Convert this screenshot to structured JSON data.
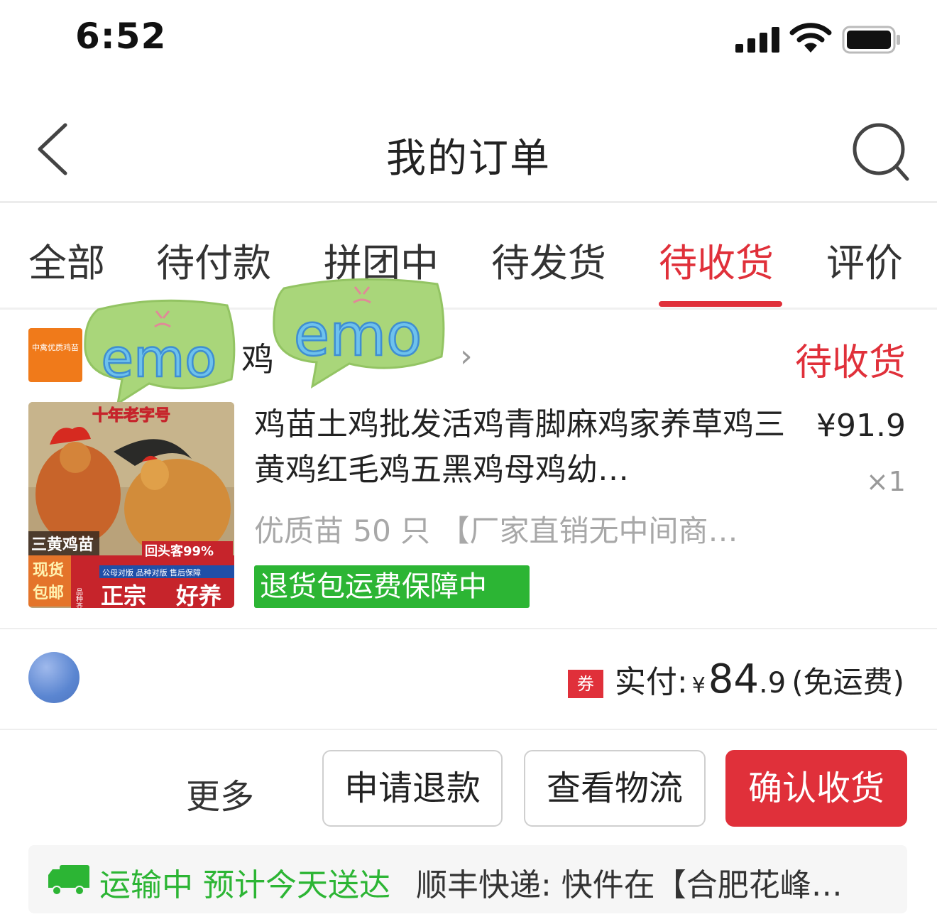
{
  "status_bar": {
    "time": "6:52"
  },
  "nav": {
    "title": "我的订单"
  },
  "tabs": [
    {
      "label": "全部"
    },
    {
      "label": "待付款"
    },
    {
      "label": "拼团中"
    },
    {
      "label": "待发货"
    },
    {
      "label": "待收货",
      "active": true
    },
    {
      "label": "评价"
    }
  ],
  "shop": {
    "logo_text": "中禽优质鸡苗",
    "name_visible": "鸡",
    "order_status": "待收货"
  },
  "sticker": {
    "text": "emo"
  },
  "product": {
    "title": "鸡苗土鸡批发活鸡青脚麻鸡家养草鸡三黄鸡红毛鸡五黑鸡母鸡幼…",
    "price": "¥91.9",
    "quantity": "×1",
    "spec": "优质苗 50 只 【厂家直销无中间商…",
    "guarantee": "退货包运费保障中",
    "image_texts": {
      "top": "十年老字号",
      "left_title": "三黄鸡苗",
      "repeat": "回头客99%",
      "stamp1": "现货",
      "stamp2": "包邮",
      "side": "品种齐全",
      "features": "公母对版 品种对版 售后保障",
      "slogan1": "正宗",
      "slogan2": "好养"
    }
  },
  "payment": {
    "coupon_icon": "券",
    "label": "实付:",
    "currency": "¥",
    "amount_int": "84",
    "amount_dec": ".9",
    "note": "(免运费)"
  },
  "actions": {
    "more": "更多",
    "refund": "申请退款",
    "logistics": "查看物流",
    "confirm": "确认收货"
  },
  "logistics": {
    "status": "运输中 预计今天送达",
    "detail": "顺丰快递: 快件在【合肥花峰…"
  },
  "colors": {
    "accent": "#e0303a",
    "green": "#2cb534",
    "shop_logo": "#f07a1a"
  }
}
